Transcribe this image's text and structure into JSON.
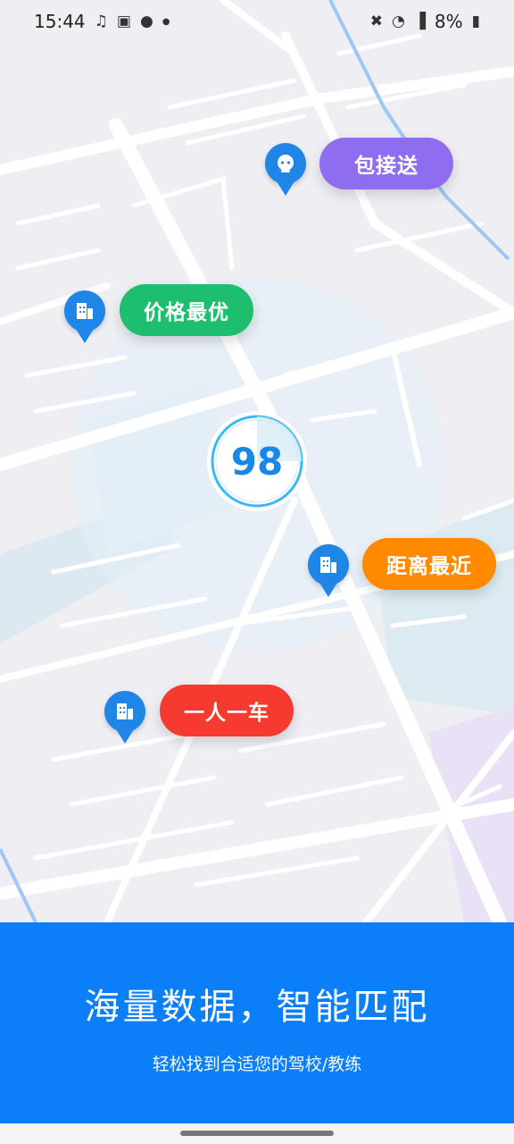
{
  "status_bar": {
    "time": "15:44",
    "left_icons": [
      "no-sound-notification-icon",
      "image-icon",
      "app-icon",
      "dot-icon"
    ],
    "battery": "8%",
    "right_icons": [
      "mute-icon",
      "wifi-icon",
      "signal-icon",
      "battery-icon"
    ]
  },
  "map": {
    "score": "98",
    "labels": {
      "pickup": "包接送",
      "best_price": "价格最优",
      "nearest": "距离最近",
      "one_per_car": "一人一车"
    },
    "colors": {
      "pickup": "#8f6df0",
      "best_price": "#1dbf6e",
      "nearest": "#ff8a00",
      "one_per_car": "#f53a30",
      "pin": "#1f86e8"
    }
  },
  "panel": {
    "headline": "海量数据，智能匹配",
    "subline": "轻松找到合适您的驾校/教练",
    "color": "#0a7ff7"
  }
}
